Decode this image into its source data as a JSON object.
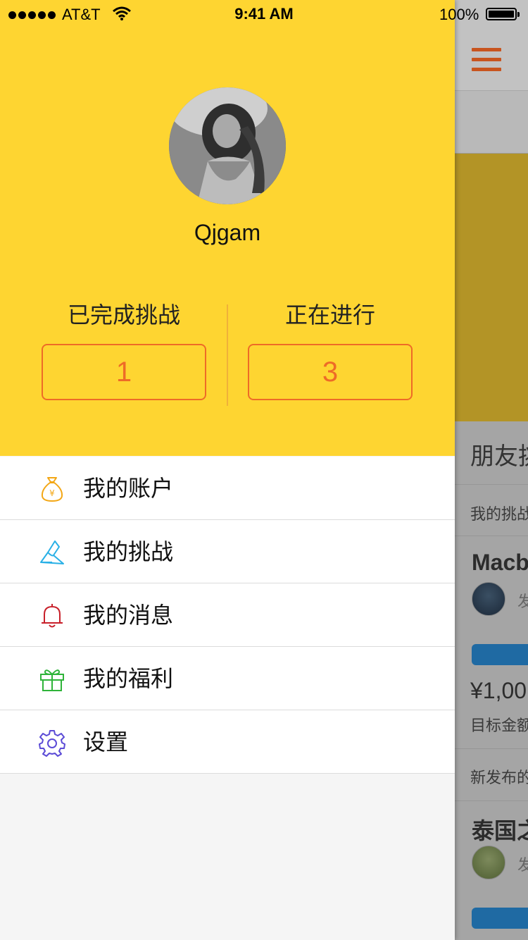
{
  "status_bar": {
    "carrier": "AT&T",
    "time": "9:41 AM",
    "battery": "100%"
  },
  "profile": {
    "username": "Qjgam",
    "stats": [
      {
        "label": "已完成挑战",
        "value": "1"
      },
      {
        "label": "正在进行",
        "value": "3"
      }
    ]
  },
  "menu": {
    "items": [
      {
        "label": "我的账户",
        "icon": "money-bag-icon",
        "color": "#f3a716"
      },
      {
        "label": "我的挑战",
        "icon": "challenge-icon",
        "color": "#29b0e6"
      },
      {
        "label": "我的消息",
        "icon": "bell-icon",
        "color": "#c8202a"
      },
      {
        "label": "我的福利",
        "icon": "gift-icon",
        "color": "#2fb43a"
      },
      {
        "label": "设置",
        "icon": "gear-icon",
        "color": "#5b4bd6"
      }
    ]
  },
  "background": {
    "section_title": "朋友挑",
    "tab_label": "我的挑战",
    "card1_title": "Macb",
    "card1_meta": "发",
    "card1_price": "¥1,00",
    "card1_target": "目标金额",
    "new_label": "新发布的",
    "card2_title": "泰国之",
    "card2_meta": "发"
  },
  "colors": {
    "header_yellow": "#fed531",
    "accent_orange": "#ee6b27"
  }
}
